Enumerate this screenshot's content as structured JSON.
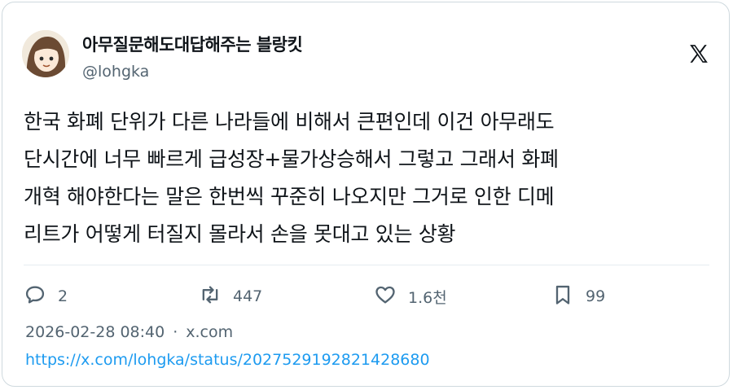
{
  "author": {
    "display_name": "아무질문해도대답해주는 블랑킷",
    "handle": "@lohgka"
  },
  "tweet": {
    "text": "한국 화폐 단위가 다른 나라들에 비해서 큰편인데 이건 아무래도\n단시간에 너무 빠르게 급성장+물가상승해서 그렇고 그래서 화폐\n개혁 해야한다는 말은 한번씩 꾸준히 나오지만 그거로 인한 디메\n리트가 어떻게 터질지 몰라서 손을 못대고 있는 상황"
  },
  "actions": {
    "reply_count": "2",
    "repost_count": "447",
    "like_count": "1.6천",
    "bookmark_count": "99"
  },
  "meta": {
    "timestamp": "2026-02-28 08:40",
    "separator": "·",
    "source": "x.com",
    "url": "https://x.com/lohgka/status/2027529192821428680"
  },
  "icons": {
    "reply": "speech-bubble-icon",
    "repost": "repost-arrows-icon",
    "like": "heart-icon",
    "bookmark": "bookmark-icon",
    "brand": "x-logo-icon"
  },
  "colors": {
    "text": "#0f1419",
    "secondary": "#536471",
    "link": "#1d9bf0",
    "border": "#cfd9de"
  }
}
